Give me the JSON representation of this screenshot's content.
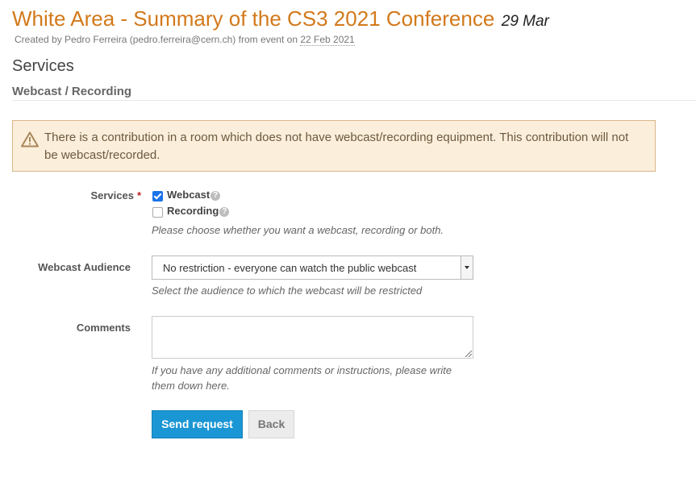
{
  "header": {
    "title": "White Area - Summary of the CS3 2021 Conference",
    "date": "29 Mar",
    "meta_prefix": "Created by Pedro Ferreira (pedro.ferreira@cern.ch) from event on ",
    "meta_date": "22 Feb 2021"
  },
  "section": {
    "title": "Services",
    "subtitle": "Webcast / Recording"
  },
  "warning": {
    "icon": "warning-triangle-icon",
    "text": "There is a contribution in a room which does not have webcast/recording equipment. This contribution will not be webcast/recorded."
  },
  "form": {
    "services": {
      "label": "Services",
      "required_mark": "*",
      "options": [
        {
          "label": "Webcast",
          "checked": true,
          "help": "?"
        },
        {
          "label": "Recording",
          "checked": false,
          "help": "?"
        }
      ],
      "hint": "Please choose whether you want a webcast, recording or both."
    },
    "audience": {
      "label": "Webcast Audience",
      "selected": "No restriction - everyone can watch the public webcast",
      "hint": "Select the audience to which the webcast will be restricted"
    },
    "comments": {
      "label": "Comments",
      "value": "",
      "hint_line1": "If you have any additional comments or instructions, please write",
      "hint_line2": "them down here."
    },
    "buttons": {
      "submit": "Send request",
      "back": "Back"
    }
  },
  "colors": {
    "accent": "#d2791b",
    "primary_button": "#1a96d4",
    "warning_bg": "#fbeedb"
  }
}
